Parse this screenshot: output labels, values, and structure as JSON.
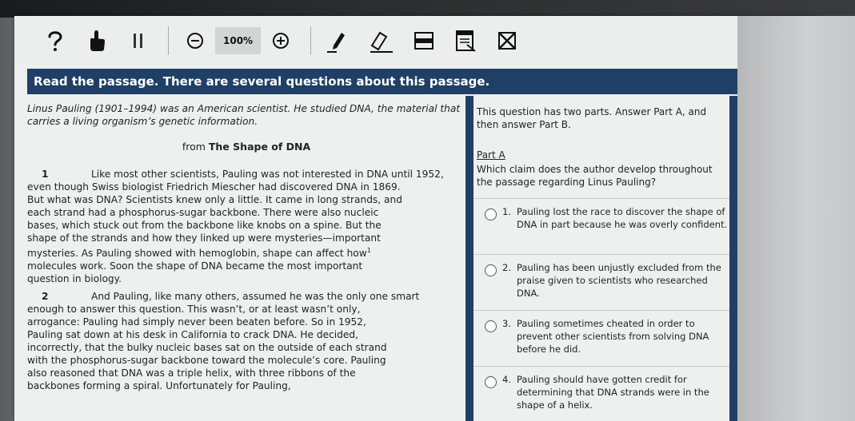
{
  "toolbar": {
    "zoom_level": "100%",
    "icons": [
      "help-icon",
      "hand-pointer-icon",
      "pause-icon",
      "zoom-out-icon",
      "zoom-in-icon",
      "pencil-icon",
      "highlighter-icon",
      "line-reader-icon",
      "notepad-icon",
      "eliminate-choice-icon"
    ]
  },
  "banner": {
    "text": "Read the passage. There are several questions about this passage."
  },
  "passage": {
    "intro": "Linus Pauling (1901–1994) was an American scientist. He studied DNA, the material that carries a living organism’s genetic information.",
    "source_prefix": "from ",
    "source_title": "The Shape of DNA",
    "paragraphs": [
      {
        "number": "1",
        "lines": [
          "Like most other scientists, Pauling was not interested in DNA until 1952,",
          "even though Swiss biologist Friedrich Miescher had discovered DNA in 1869.",
          "But what was DNA? Scientists knew only a little. It came in long strands, and",
          "each strand had a phosphorus-sugar backbone. There were also nucleic",
          "bases, which stuck out from the backbone like knobs on a spine. But the",
          "shape of the strands and how they linked up were mysteries—important",
          "mysteries. As Pauling showed with hemoglobin, shape can affect how",
          "molecules work. Soon the shape of DNA became the most important",
          "question in biology."
        ],
        "footnote_mark": "1"
      },
      {
        "number": "2",
        "lines": [
          "And Pauling, like many others, assumed he was the only one smart",
          "enough to answer this question. This wasn’t, or at least wasn’t only,",
          "arrogance: Pauling had simply never been beaten before. So in 1952,",
          "Pauling sat down at his desk in California to crack DNA. He decided,",
          "incorrectly, that the bulky nucleic bases sat on the outside of each strand",
          "with the phosphorus-sugar backbone toward the molecule’s core. Pauling",
          "also reasoned that DNA was a triple helix, with three ribbons of the",
          "backbones forming a spiral. Unfortunately for Pauling,"
        ]
      }
    ]
  },
  "question": {
    "prompt": "This question has two parts. Answer Part A, and then answer Part B.",
    "part_label": "Part A",
    "text": "Which claim does the author develop throughout the passage regarding Linus Pauling?",
    "options": [
      {
        "number": "1.",
        "text": "Pauling lost the race to discover the shape of DNA in part because he was overly confident."
      },
      {
        "number": "2.",
        "text": "Pauling has been unjustly excluded from the praise given to scientists who researched DNA."
      },
      {
        "number": "3.",
        "text": "Pauling sometimes cheated in order to prevent other scientists from solving DNA before he did."
      },
      {
        "number": "4.",
        "text": "Pauling should have gotten credit for determining that DNA strands were in the shape of a helix."
      }
    ]
  },
  "colors": {
    "banner": "#1f3f66",
    "page_background": "#eef0ef",
    "text": "#222222"
  }
}
